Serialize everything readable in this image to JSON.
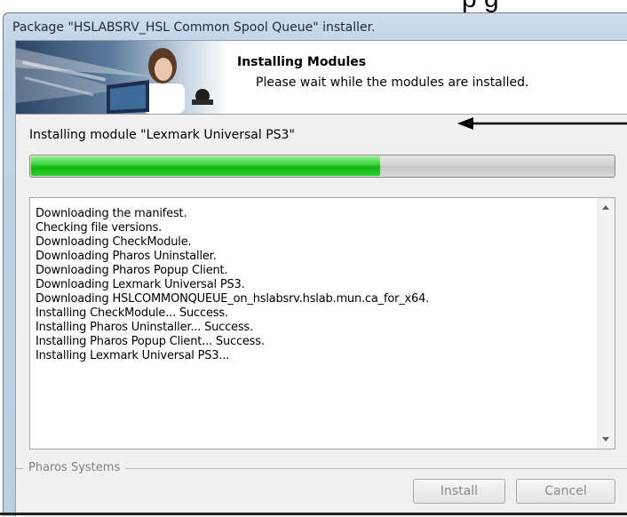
{
  "top_fragment": "p g",
  "window": {
    "title": "Package \"HSLABSRV_HSL Common Spool Queue\" installer."
  },
  "header": {
    "title": "Installing Modules",
    "subtitle": "Please wait while the modules are installed."
  },
  "progress": {
    "label": "Installing module \"Lexmark Universal PS3\"",
    "percent": 60
  },
  "log": {
    "lines": [
      "Downloading the manifest.",
      "Checking file versions.",
      "Downloading CheckModule.",
      "Downloading Pharos Uninstaller.",
      "Downloading Pharos Popup Client.",
      "Downloading Lexmark Universal PS3.",
      "Downloading HSLCOMMONQUEUE_on_hslabsrv.hslab.mun.ca_for_x64.",
      "Installing CheckModule... Success.",
      "Installing Pharos Uninstaller... Success.",
      "Installing Pharos Popup Client... Success.",
      "Installing Lexmark Universal PS3..."
    ]
  },
  "footer": {
    "group_label": "Pharos Systems",
    "install_label": "Install",
    "cancel_label": "Cancel"
  },
  "icons": {
    "arrow": "left-arrow-icon"
  }
}
